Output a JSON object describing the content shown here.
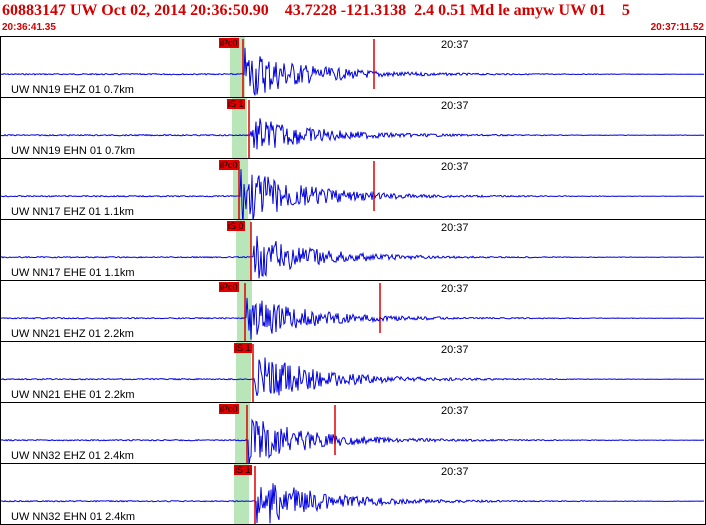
{
  "header": {
    "title": "60883147 UW Oct 02, 2014 20:36:50.90    43.7228 -121.3138  2.4 0.51 Md le amyw UW 01    5",
    "start_time": "20:36:41.35",
    "end_time": "20:37:11.52"
  },
  "colors": {
    "trace": "#0000e0",
    "pick": "#e00000",
    "shade": "#b9e6b9",
    "text_red": "#d40000"
  },
  "channels": [
    {
      "label": "UW NN19 EHZ 01 0.7km",
      "time_label": "20:37",
      "pick_label": "iPc0",
      "pick_type": "P"
    },
    {
      "label": "UW NN19 EHN 01 0.7km",
      "time_label": "20:37",
      "pick_label": "iS 1",
      "pick_type": "S"
    },
    {
      "label": "UW NN17 EHZ 01 1.1km",
      "time_label": "20:37",
      "pick_label": "iPc0",
      "pick_type": "P"
    },
    {
      "label": "UW NN17 EHE 01 1.1km",
      "time_label": "20:37",
      "pick_label": "iS 0",
      "pick_type": "S"
    },
    {
      "label": "UW NN21 EHZ 01 2.2km",
      "time_label": "20:37",
      "pick_label": "iPc0",
      "pick_type": "P"
    },
    {
      "label": "UW NN21 EHE 01 2.2km",
      "time_label": "20:37",
      "pick_label": "iS 1",
      "pick_type": "S"
    },
    {
      "label": "UW NN32 EHZ 01 2.4km",
      "time_label": "20:37",
      "pick_label": "iPc0",
      "pick_type": "P"
    },
    {
      "label": "UW NN32 EHN 01 2.4km",
      "time_label": "20:37",
      "pick_label": "iS 1",
      "pick_type": "S"
    }
  ]
}
